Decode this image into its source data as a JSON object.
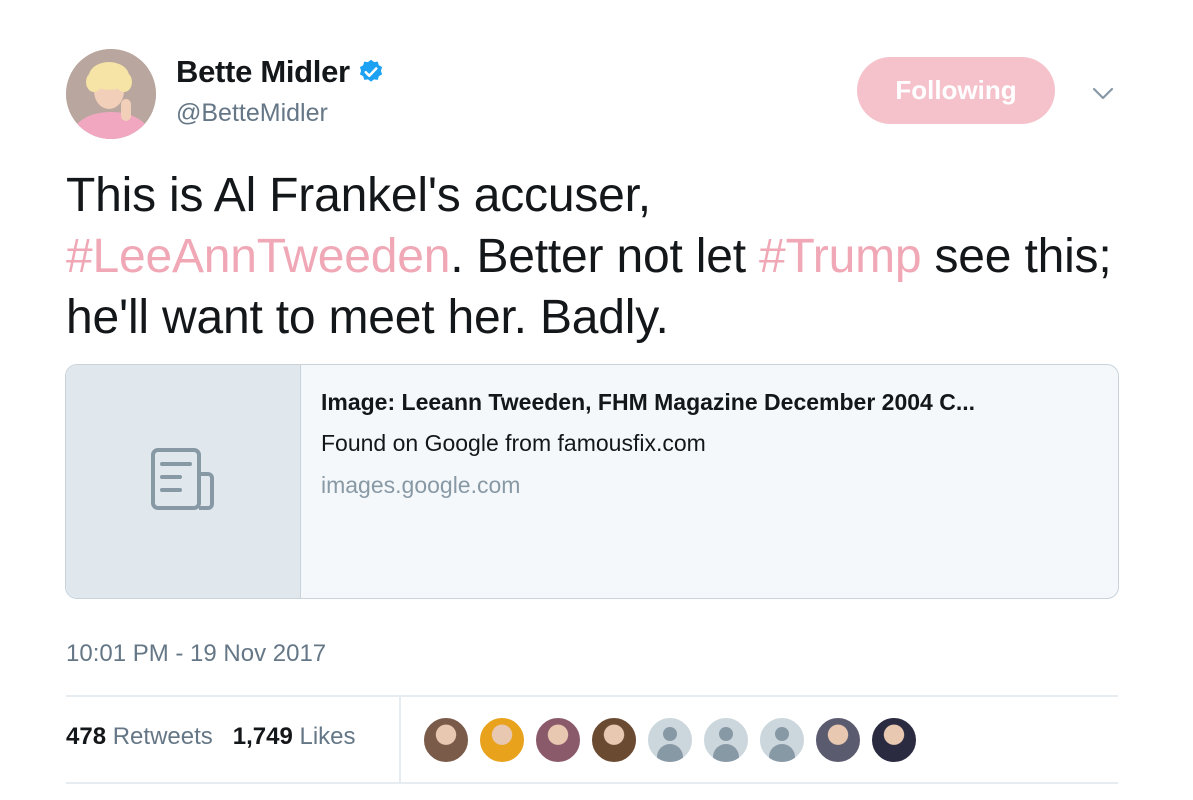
{
  "user": {
    "name": "Bette Midler",
    "handle": "@BetteMidler",
    "verified_color": "#1da1f2"
  },
  "follow_button": {
    "label": "Following",
    "color": "#f5c2cc"
  },
  "tweet": {
    "parts": [
      {
        "text": "This is Al Frankel's accuser, ",
        "hashtag": false
      },
      {
        "text": "#LeeAnnTweeden",
        "hashtag": true
      },
      {
        "text": ".  Better not let ",
        "hashtag": false
      },
      {
        "text": "#Trump",
        "hashtag": true
      },
      {
        "text": " see this; he'll want to meet her.  Badly.",
        "hashtag": false
      }
    ],
    "hashtag_color": "#f0a8b6"
  },
  "card": {
    "title": "Image: Leeann Tweeden, FHM Magazine December 2004 C...",
    "description": "Found on Google from famousfix.com",
    "domain": "images.google.com",
    "thumb_icon": "document-icon"
  },
  "timestamp": "10:01 PM - 19 Nov 2017",
  "stats": {
    "retweets_count": "478",
    "retweets_label": "Retweets",
    "likes_count": "1,749",
    "likes_label": "Likes"
  },
  "likers": [
    {
      "type": "photo",
      "color": "#7a5a48"
    },
    {
      "type": "photo",
      "color": "#e8a21c"
    },
    {
      "type": "photo",
      "color": "#8a5a6a"
    },
    {
      "type": "photo",
      "color": "#6b4a32"
    },
    {
      "type": "default"
    },
    {
      "type": "default"
    },
    {
      "type": "default"
    },
    {
      "type": "photo",
      "color": "#5b5b70"
    },
    {
      "type": "photo",
      "color": "#2a2a40"
    }
  ]
}
